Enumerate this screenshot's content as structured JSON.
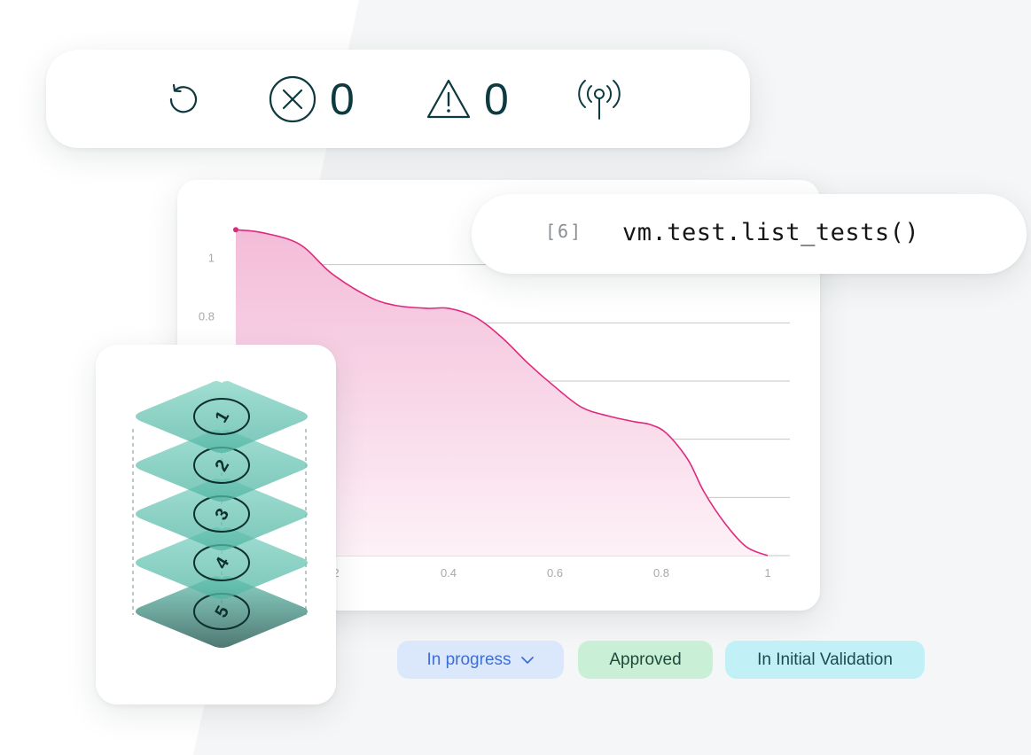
{
  "status_bar": {
    "refresh_icon": "refresh-icon",
    "error_icon": "error-circle-x-icon",
    "error_count": "0",
    "warning_icon": "warning-triangle-icon",
    "warning_count": "0",
    "broadcast_icon": "broadcast-antenna-icon"
  },
  "code_cell": {
    "prompt": "[6]",
    "code": "vm.test.list_tests()"
  },
  "chart_data": {
    "type": "area",
    "title": "",
    "xlabel": "",
    "ylabel": "",
    "x_ticks": [
      "2",
      "0.4",
      "0.6",
      "0.8",
      "1"
    ],
    "y_ticks": [
      "1",
      "0.8"
    ],
    "xlim": [
      0,
      1
    ],
    "ylim": [
      0,
      1.2
    ],
    "grid": true,
    "series": [
      {
        "x": [
          0,
          0.05,
          0.12,
          0.18,
          0.25,
          0.3,
          0.36,
          0.4,
          0.45,
          0.5,
          0.55,
          0.6,
          0.65,
          0.7,
          0.75,
          0.78,
          0.81,
          0.85,
          0.88,
          0.92,
          0.96,
          1.0
        ],
        "y": [
          1.12,
          1.11,
          1.07,
          0.97,
          0.89,
          0.86,
          0.85,
          0.85,
          0.82,
          0.75,
          0.66,
          0.58,
          0.51,
          0.48,
          0.46,
          0.45,
          0.42,
          0.33,
          0.22,
          0.11,
          0.03,
          0.0
        ]
      }
    ],
    "colors": {
      "line": "#e0287d",
      "fill_top": "#f3bcd8",
      "fill_bottom": "#fdf1f7",
      "grid": "#c6c6c6",
      "tick": "#a9a9a9"
    }
  },
  "layers": {
    "labels": [
      "1",
      "2",
      "3",
      "4",
      "5"
    ],
    "color": "#5cc3b0"
  },
  "pills": {
    "in_progress": "In progress",
    "approved": "Approved",
    "initial_validation": "In Initial Validation"
  }
}
